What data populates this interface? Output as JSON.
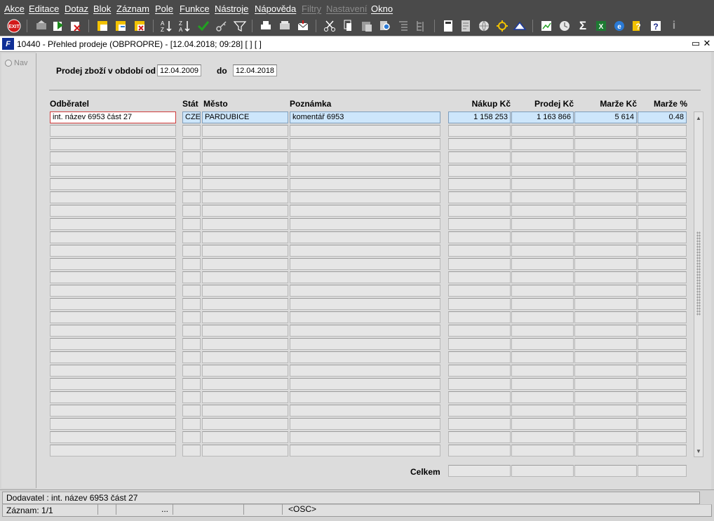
{
  "menu": [
    "Akce",
    "Editace",
    "Dotaz",
    "Blok",
    "Záznam",
    "Pole",
    "Funkce",
    "Nástroje",
    "Nápověda",
    "Filtry",
    "Nastavení",
    "Okno"
  ],
  "window": {
    "app_icon": "F",
    "title": "10440 - Přehled prodeje (OBPROPRE) - [12.04.2018; 09:28]  [ ]  [ ]"
  },
  "nav": {
    "label": "Nav"
  },
  "filter": {
    "from_label": "Prodej zboží v období od",
    "from_value": "12.04.2009",
    "to_label": "do",
    "to_value": "12.04.2018"
  },
  "table": {
    "headers": [
      "Odběratel",
      "Stát",
      "Město",
      "Poznámka",
      "Nákup Kč",
      "Prodej Kč",
      "Marže Kč",
      "Marže %"
    ],
    "rows": [
      [
        "int. název 6953 část 27",
        "CZE",
        "PARDUBICE",
        "komentář 6953",
        "1 158 253",
        "1 163 866",
        "5 614",
        "0.48"
      ]
    ],
    "empty_rows": 25
  },
  "totals": {
    "label": "Celkem"
  },
  "status": {
    "line1": "Dodavatel : int. název 6953 část 27",
    "line2_record": "Záznam: 1/1",
    "line2_dots": "...",
    "line2_mode": "<OSC>"
  },
  "icons": [
    "exit-icon",
    "insert-record-icon",
    "save-icon",
    "delete-record-icon",
    "lock-icon",
    "refresh-icon",
    "clear-icon",
    "sort-asc-icon",
    "sort-desc-icon",
    "check-icon",
    "key-icon",
    "filter-icon",
    "print-icon",
    "print-setup-icon",
    "mail-icon",
    "cut-icon",
    "copy-icon",
    "paste-icon",
    "zoom-icon",
    "list-icon",
    "tree-icon",
    "calculator-icon",
    "report-icon",
    "globe-icon",
    "settings-icon",
    "triangle-icon",
    "chart-icon",
    "clock-icon",
    "sum-icon",
    "excel-icon",
    "browser-icon",
    "help-icon",
    "context-help-icon",
    "info-icon"
  ]
}
